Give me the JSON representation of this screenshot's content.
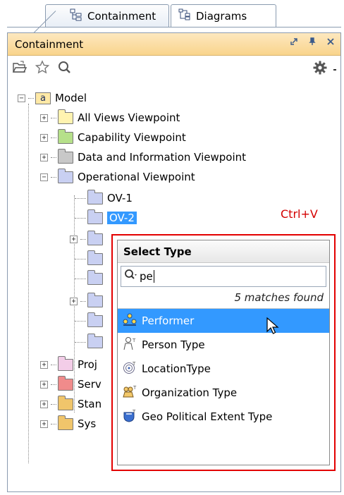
{
  "tabs": [
    {
      "label": "Containment",
      "icon": "containment-tree-icon",
      "active": true
    },
    {
      "label": "Diagrams",
      "icon": "diagrams-icon",
      "active": false
    }
  ],
  "panel": {
    "title": "Containment",
    "controls": [
      "restore-icon",
      "pin-icon",
      "close-icon"
    ]
  },
  "toolbar": {
    "icons": [
      "open-folder-icon",
      "star-icon",
      "search-icon"
    ],
    "right_icons": [
      "gear-icon",
      "dropdown-arrow-icon"
    ]
  },
  "tree": {
    "root": {
      "label": "Model",
      "icon_letter": "a"
    },
    "items": [
      {
        "label": "All Views Viewpoint",
        "color": "#fff3b0"
      },
      {
        "label": "Capability Viewpoint",
        "color": "#b6e08a"
      },
      {
        "label": "Data and Information Viewpoint",
        "color": "#c8c8c8"
      },
      {
        "label": "Operational Viewpoint",
        "color": "#c9d0f2"
      },
      {
        "label": "OV-1",
        "color": "#c9d0f2"
      },
      {
        "label": "OV-2",
        "color": "#c9d0f2",
        "selected": true
      },
      {
        "label": "",
        "color": "#c9d0f2"
      },
      {
        "label": "",
        "color": "#c9d0f2"
      },
      {
        "label": "",
        "color": "#c9d0f2"
      },
      {
        "label": "",
        "color": "#c9d0f2"
      },
      {
        "label": "",
        "color": "#c9d0f2"
      },
      {
        "label": "",
        "color": "#c9d0f2"
      },
      {
        "label": "Proj",
        "color": "#f3cde8"
      },
      {
        "label": "Serv",
        "color": "#f08b8b"
      },
      {
        "label": "Stan",
        "color": "#f0c56b"
      },
      {
        "label": "Sys",
        "color": "#f0c56b"
      }
    ]
  },
  "shortcut_label": "Ctrl+V",
  "popup": {
    "title": "Select Type",
    "search_value": "pe",
    "match_count": "5 matches found",
    "options": [
      {
        "label": "Performer",
        "icon": "performer-icon",
        "highlighted": true
      },
      {
        "label": "Person Type",
        "icon": "person-type-icon"
      },
      {
        "label": "LocationType",
        "icon": "location-type-icon"
      },
      {
        "label": "Organization Type",
        "icon": "organization-type-icon"
      },
      {
        "label": "Geo Political Extent Type",
        "icon": "geo-political-extent-type-icon"
      }
    ]
  },
  "colors": {
    "accent": "#3399ff",
    "highlight_frame": "#e30000",
    "panel_title": "#f9d48c"
  }
}
